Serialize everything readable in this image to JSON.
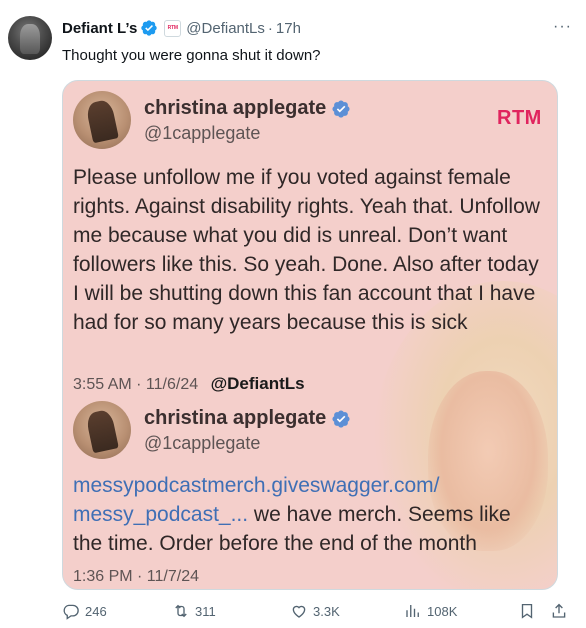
{
  "author": {
    "display_name": "Defiant L’s",
    "handle": "@DefiantLs",
    "separator": "·",
    "time": "17h",
    "brand_badge": "RTM"
  },
  "tweet_text": "Thought you were gonna shut it down?",
  "quoted_image": {
    "brand": "RTM",
    "post1": {
      "name": "christina applegate",
      "handle": "@1capplegate",
      "text": "Please unfollow me if you voted against female rights. Against disability rights. Yeah that. Unfollow me because what you did is unreal. Don’t want followers like this. So yeah. Done. Also after today I will be shutting down this fan account that I have had for so many years because this is sick",
      "timestamp": "3:55 AM · 11/6/24",
      "source": "@DefiantLs"
    },
    "post2": {
      "name": "christina applegate",
      "handle": "@1capplegate",
      "link": "messypodcastmerch.giveswagger.com/ messy_podcast_...",
      "text": " we have merch. Seems like the time. Order before the end of the month",
      "timestamp": "1:36 PM · 11/7/24"
    }
  },
  "actions": {
    "replies": "246",
    "retweets": "311",
    "likes": "3.3K",
    "views": "108K"
  },
  "more_label": "···",
  "colors": {
    "verified": "#1d9bf0",
    "link": "#3f6fb5",
    "brand": "#e0245e",
    "image_background": "#f4cfcb"
  }
}
